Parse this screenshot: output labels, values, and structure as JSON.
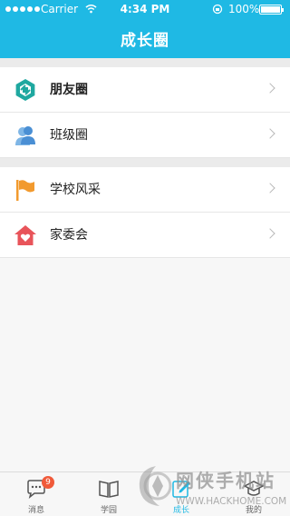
{
  "status_bar": {
    "carrier": "Carrier",
    "time": "4:34 PM",
    "battery": "100%"
  },
  "header": {
    "title": "成长圈",
    "background": "#1fb9e4"
  },
  "groups": [
    {
      "items": [
        {
          "label": "朋友圈",
          "icon": "friends-circle-icon",
          "color": "#1fa8a0"
        },
        {
          "label": "班级圈",
          "icon": "class-people-icon",
          "color": "#5a9bd8"
        }
      ]
    },
    {
      "items": [
        {
          "label": "学校风采",
          "icon": "flag-icon",
          "color": "#f29a2e"
        },
        {
          "label": "家委会",
          "icon": "home-heart-icon",
          "color": "#e8545a"
        }
      ]
    }
  ],
  "tabbar": {
    "tabs": [
      {
        "label": "消息",
        "icon": "chat-bubble-icon",
        "badge": "9"
      },
      {
        "label": "学园",
        "icon": "book-icon"
      },
      {
        "label": "成长",
        "icon": "edit-icon",
        "active": true
      },
      {
        "label": "我的",
        "icon": "graduation-cap-icon"
      }
    ],
    "active_color": "#1fb9e4"
  },
  "watermark": {
    "text_top": "网侠手机站",
    "text_bottom": "WWW.HACKHOME.COM"
  }
}
